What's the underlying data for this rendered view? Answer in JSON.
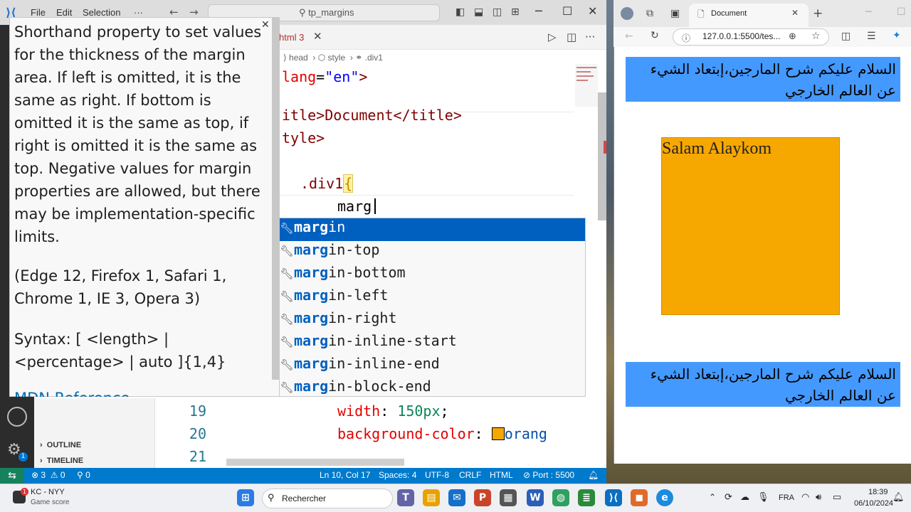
{
  "vscode": {
    "menu": [
      "File",
      "Edit",
      "Selection",
      "···"
    ],
    "search_text": "tp_margins",
    "tab_label": "html 3",
    "breadcrumb": [
      "head",
      "style",
      ".div1"
    ],
    "code_top": {
      "line1_attr": "lang",
      "line1_eq": "=",
      "line1_val": "\"en\"",
      "line1_close": ">",
      "line2": "itle>Document</title>",
      "line3": "tyle>",
      "selector": ".div1",
      "brace": "{",
      "typed": "marg"
    },
    "line_numbers": [
      "19",
      "20",
      "21"
    ],
    "code_bottom": {
      "width_prop": "width",
      "width_val": "150px",
      "bg_prop": "background-color",
      "bg_val": "orang"
    },
    "sidebar": [
      "OUTLINE",
      "TIMELINE"
    ],
    "status": {
      "remote": "⇆",
      "problems": "⊗ 3  ⚠ 0",
      "ports": "⚲ 0",
      "position": "Ln 10, Col 17",
      "spaces": "Spaces: 4",
      "encoding": "UTF-8",
      "eol": "CRLF",
      "language": "HTML",
      "port": "⊘ Port : 5500"
    }
  },
  "autocomplete": {
    "match": "marg",
    "items": [
      {
        "rest": "in",
        "active": true
      },
      {
        "rest": "in-top"
      },
      {
        "rest": "in-bottom"
      },
      {
        "rest": "in-left"
      },
      {
        "rest": "in-right"
      },
      {
        "rest": "in-inline-start"
      },
      {
        "rest": "in-inline-end"
      },
      {
        "rest": "in-block-end"
      }
    ]
  },
  "doc_panel": {
    "description": "Shorthand property to set values for the thickness of the margin area. If left is omitted, it is the same as right. If bottom is omitted it is the same as top, if right is omitted it is the same as top. Negative values for margin properties are allowed, but there may be implementation-specific limits.",
    "compat": "(Edge 12, Firefox 1, Safari 1, Chrome 1, IE 3, Opera 3)",
    "syntax": "Syntax: [ <length> | <percentage> | auto ]{1,4}",
    "link": "MDN Reference"
  },
  "browser": {
    "tab_title": "Document",
    "url": "127.0.0.1:5500/tes...",
    "arabic_top": "السلام عليكم شرح المارجين،إبتعاد الشيء عن العالم الخارجي",
    "box_text": "Salam Alaykom",
    "arabic_bottom": "السلام عليكم شرح المارجين،إبتعاد الشيء عن العالم الخارجي",
    "colors": {
      "blue_box": "#4499ff",
      "orange_box": "#f7a800"
    }
  },
  "taskbar": {
    "weather_title": "KC - NYY",
    "weather_sub": "Game score",
    "search_placeholder": "Rechercher",
    "lang": "FRA",
    "time": "18:39",
    "date": "06/10/2024"
  }
}
